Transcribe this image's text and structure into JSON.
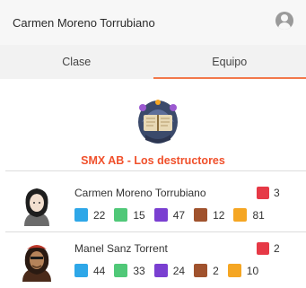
{
  "header": {
    "title": "Carmen Moreno Torrubiano",
    "avatar_icon": "user-circle-icon"
  },
  "tabs": [
    {
      "label": "Clase",
      "active": false
    },
    {
      "label": "Equipo",
      "active": true
    }
  ],
  "team": {
    "name": "SMX AB - Los destructores",
    "logo_icon": "spellbook-crest-icon"
  },
  "colors": {
    "accent": "#f2784b",
    "team_name": "#f0502b",
    "badge_red": "#e63946"
  },
  "members": [
    {
      "name": "Carmen Moreno Torrubiano",
      "badge_value": "3",
      "badge_icon": "red-person-icon",
      "stats": [
        {
          "icon": "blue-running-icon",
          "value": "22"
        },
        {
          "icon": "green-running-icon",
          "value": "15"
        },
        {
          "icon": "purple-orb-icon",
          "value": "47"
        },
        {
          "icon": "brown-chest-icon",
          "value": "12"
        },
        {
          "icon": "orange-flame-icon",
          "value": "81"
        }
      ]
    },
    {
      "name": "Manel Sanz Torrent",
      "badge_value": "2",
      "badge_icon": "red-person-icon",
      "stats": [
        {
          "icon": "blue-running-icon",
          "value": "44"
        },
        {
          "icon": "green-running-icon",
          "value": "33"
        },
        {
          "icon": "purple-orb-icon",
          "value": "24"
        },
        {
          "icon": "brown-chest-icon",
          "value": "2"
        },
        {
          "icon": "orange-flame-icon",
          "value": "10"
        }
      ]
    }
  ]
}
